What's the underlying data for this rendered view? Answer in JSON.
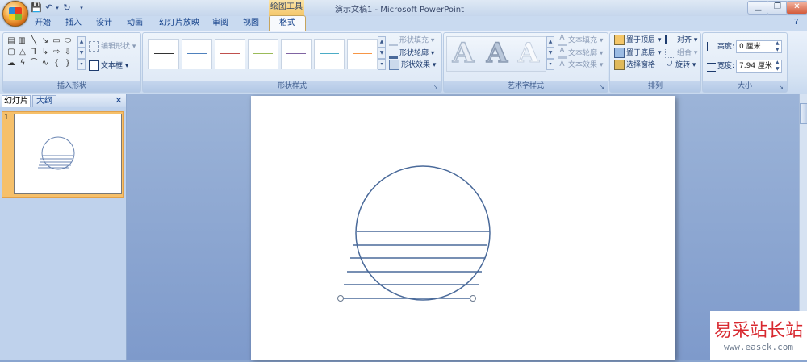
{
  "titlebar": {
    "title": "演示文稿1 - Microsoft PowerPoint",
    "contextual_tool": "绘图工具",
    "qat_icons": [
      "save-icon",
      "undo-icon",
      "redo-icon",
      "customize-icon"
    ],
    "window_buttons": [
      "minimize",
      "restore",
      "close"
    ]
  },
  "tabs": [
    "开始",
    "插入",
    "设计",
    "动画",
    "幻灯片放映",
    "审阅",
    "视图"
  ],
  "active_tab": "格式",
  "ribbon": {
    "insert_shapes": {
      "label": "插入形状",
      "edit_shape": "编辑形状",
      "text_box": "文本框"
    },
    "shape_styles": {
      "label": "形状样式",
      "fill": "形状填充",
      "outline": "形状轮廓",
      "effects": "形状效果",
      "line_colors": [
        "#333333",
        "#4f81bd",
        "#c0504d",
        "#9bbb59",
        "#8064a2",
        "#4bacc6",
        "#f79646"
      ]
    },
    "wordart": {
      "label": "艺术字样式",
      "glyph": "A",
      "text_fill": "文本填充",
      "text_outline": "文本轮廓",
      "text_effects": "文本效果"
    },
    "arrange": {
      "label": "排列",
      "bring_front": "置于顶层",
      "send_back": "置于底层",
      "selection_pane": "选择窗格",
      "align": "对齐",
      "group": "组合",
      "rotate": "旋转"
    },
    "size": {
      "label": "大小",
      "height_label": "高度:",
      "height_value": "0 厘米",
      "width_label": "宽度:",
      "width_value": "7.94 厘米"
    }
  },
  "left_pane": {
    "tab_slides": "幻灯片",
    "tab_outline": "大纲",
    "close": "✕",
    "slide_number": "1"
  },
  "watermark": {
    "title": "易采站长站",
    "url": "www.easck.com"
  },
  "slide": {
    "stroke_color": "#4a6a9a",
    "shapes": "circle with six horizontal lines"
  }
}
